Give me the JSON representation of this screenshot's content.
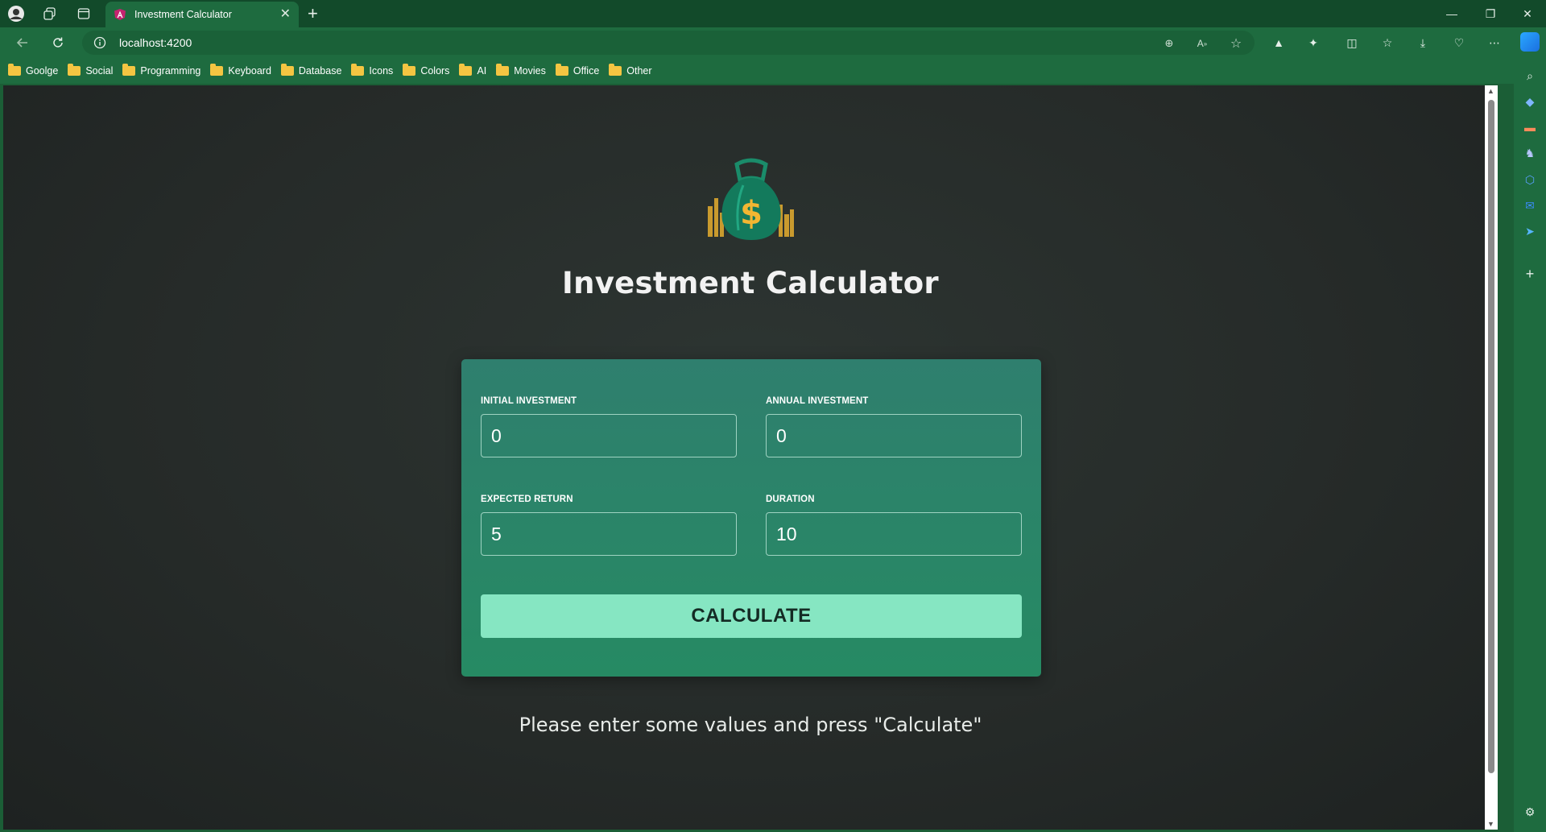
{
  "browser": {
    "tab_title": "Investment Calculator",
    "url": "localhost:4200",
    "bookmarks": [
      "Goolge",
      "Social",
      "Programming",
      "Keyboard",
      "Database",
      "Icons",
      "Colors",
      "AI",
      "Movies",
      "Office",
      "Other"
    ]
  },
  "page": {
    "title": "Investment Calculator",
    "hint": "Please enter some values and press \"Calculate\""
  },
  "form": {
    "initial_investment": {
      "label": "INITIAL INVESTMENT",
      "value": "0"
    },
    "annual_investment": {
      "label": "ANNUAL INVESTMENT",
      "value": "0"
    },
    "expected_return": {
      "label": "EXPECTED RETURN",
      "value": "5"
    },
    "duration": {
      "label": "DURATION",
      "value": "10"
    },
    "submit_label": "CALCULATE"
  },
  "colors": {
    "browser_frame": "#1e6b3f",
    "card": "#2f7f6e",
    "button": "#86e6c2",
    "page_bg": "#262b29"
  }
}
